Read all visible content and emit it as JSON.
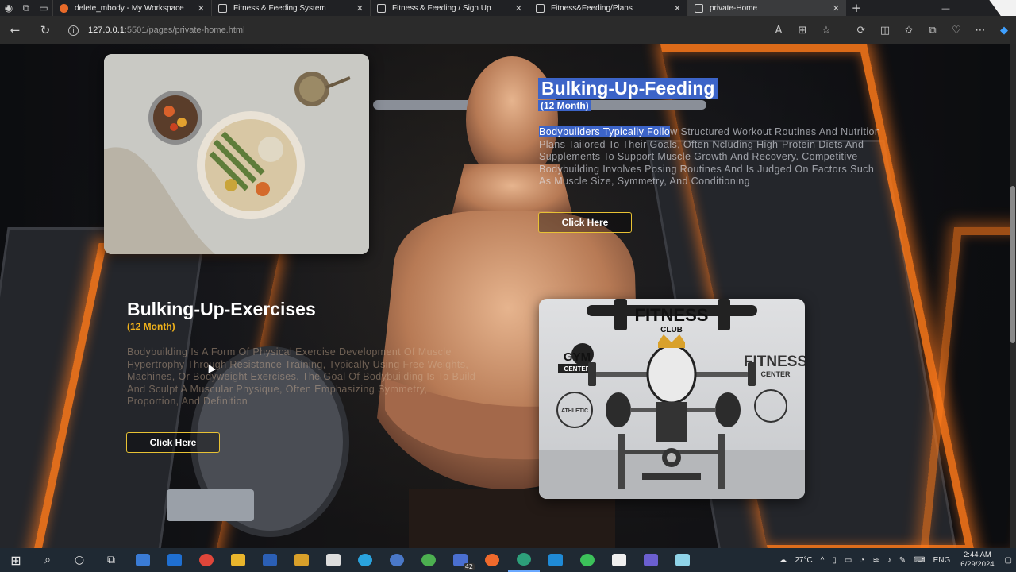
{
  "browser": {
    "tabs": [
      {
        "title": "delete_mbody - My Workspace",
        "active": false,
        "favicon": "postman-icon"
      },
      {
        "title": "Fitness & Feeding System",
        "active": false,
        "favicon": "page-icon"
      },
      {
        "title": "Fitness & Feeding / Sign Up",
        "active": false,
        "favicon": "page-icon"
      },
      {
        "title": "Fitness&Feeding/Plans",
        "active": false,
        "favicon": "page-icon"
      },
      {
        "title": "private-Home",
        "active": true,
        "favicon": "page-icon"
      }
    ],
    "close_glyph": "✕",
    "new_tab_glyph": "+",
    "url_host": "127.0.0.1",
    "url_path": ":5501/pages/private-home.html"
  },
  "sections": {
    "feeding": {
      "title": "Bulking-Up-Feeding",
      "duration": "(12 Month)",
      "desc_highlight": "Bodybuilders Typically Follo",
      "desc_rest": "w Structured Workout Routines And Nutrition Plans Tailored To Their Goals, Often Ncluding High-Protein Diets And Supplements To Support Muscle Growth And Recovery. Competitive Bodybuilding Involves Posing Routines And Is Judged On Factors Such As Muscle Size, Symmetry, And Conditioning",
      "button": "Click Here"
    },
    "exercises": {
      "title": "Bulking-Up-Exercises",
      "duration": "(12 Month)",
      "desc": "Bodybuilding Is A Form Of Physical Exercise Development Of Muscle Hypertrophy Through Resistance Training, Typically Using Free Weights, Machines, Or Bodyweight Exercises. The Goal Of Bodybuilding Is To Build And Sculpt A Muscular Physique, Often Emphasizing Symmetry, Proportion, And Definition",
      "button": "Click Here"
    }
  },
  "fitness_logo": {
    "top": "FITNESS",
    "club": "CLUB",
    "gym": "GYM",
    "center": "CENTER",
    "right": "FITNESS",
    "right_center": "CENTER",
    "badge": "ATHLETIC"
  },
  "taskbar": {
    "temperature": "27°C",
    "language": "ENG",
    "time": "2:44 AM",
    "date": "6/29/2024",
    "badge_count": "42"
  },
  "colors": {
    "accent_orange": "#ff7a1a",
    "selection_blue": "#3c64c8",
    "gold": "#f0b21b",
    "button_border": "#e8c234"
  }
}
